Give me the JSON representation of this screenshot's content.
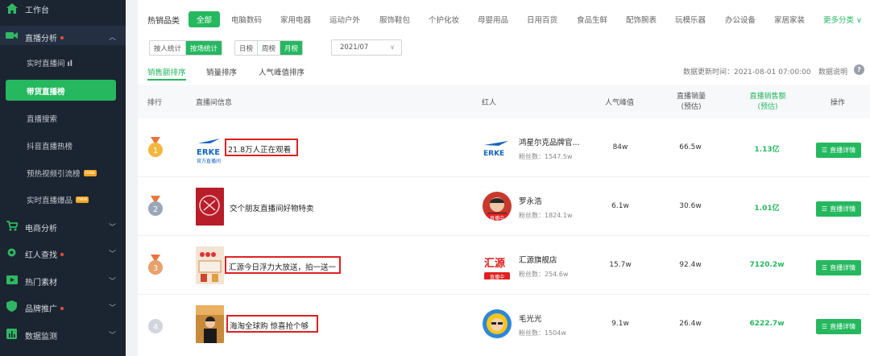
{
  "sidebar": {
    "workbench": "工作台",
    "live_analysis": "直播分析",
    "items": [
      {
        "label": "实时直播间"
      },
      {
        "label": "带货直播榜"
      },
      {
        "label": "直播搜索"
      },
      {
        "label": "抖音直播热榜"
      },
      {
        "label": "预热视频引流榜",
        "badge": "new"
      },
      {
        "label": "实时直播爆品",
        "badge": "new"
      }
    ],
    "groups": [
      {
        "label": "电商分析"
      },
      {
        "label": "红人查找"
      },
      {
        "label": "热门素材"
      },
      {
        "label": "品牌推广"
      },
      {
        "label": "数据监测"
      }
    ]
  },
  "categories": {
    "title": "热销品类",
    "active": "全部",
    "items": [
      "电脑数码",
      "家用电器",
      "运动户外",
      "服饰鞋包",
      "个护化妆",
      "母婴用品",
      "日用百货",
      "食品生鲜",
      "配饰腕表",
      "玩模乐器",
      "办公设备",
      "家居家装"
    ],
    "more": "更多分类"
  },
  "filters": {
    "stat_type": [
      "按人统计",
      "按场统计"
    ],
    "period": [
      "日榜",
      "周榜",
      "月榜"
    ],
    "date": "2021/07"
  },
  "tabs": [
    "销售额排序",
    "销量排序",
    "人气峰值排序"
  ],
  "update_time": "数据更新时间：2021-08-01 07:00:00",
  "help": "数据说明",
  "table": {
    "headers": {
      "rank": "排行",
      "info": "直播间信息",
      "influencer": "红人",
      "peak": "人气峰值",
      "sales_1": "直播销量",
      "sales_2": "(预估)",
      "revenue_1": "直播销售额",
      "revenue_2": "(预估)",
      "op": "操作"
    },
    "rows": [
      {
        "rank": "1",
        "title": "21.8万人正在观看",
        "influencer": "鸿星尔克品牌官...",
        "fans": "粉丝数：1547.5w",
        "peak": "84w",
        "sales": "66.5w",
        "revenue": "1.13亿",
        "action": "直播详情",
        "thumb_text": "ERKE",
        "thumb_sub": "官方直播间"
      },
      {
        "rank": "2",
        "title": "交个朋友直播间好物特卖",
        "influencer": "罗永浩",
        "fans": "粉丝数：1824.1w",
        "peak": "6.1w",
        "sales": "30.6w",
        "revenue": "1.01亿",
        "action": "直播详情",
        "live": "直播中"
      },
      {
        "rank": "3",
        "title": "汇源今日浮力大放送，拍一送一",
        "influencer": "汇源旗舰店",
        "fans": "粉丝数：254.6w",
        "peak": "15.7w",
        "sales": "92.4w",
        "revenue": "7120.2w",
        "action": "直播详情",
        "live": "直播中",
        "avatar_text": "汇源"
      },
      {
        "rank": "4",
        "title": "海淘全球购 惊喜抢个够",
        "influencer": "毛光光",
        "fans": "粉丝数：1504w",
        "peak": "9.1w",
        "sales": "26.4w",
        "revenue": "6222.7w",
        "action": "直播详情"
      }
    ]
  },
  "colors": {
    "accent": "#25b85f",
    "sidebar": "#1b2431",
    "highlight": "#e02020"
  }
}
